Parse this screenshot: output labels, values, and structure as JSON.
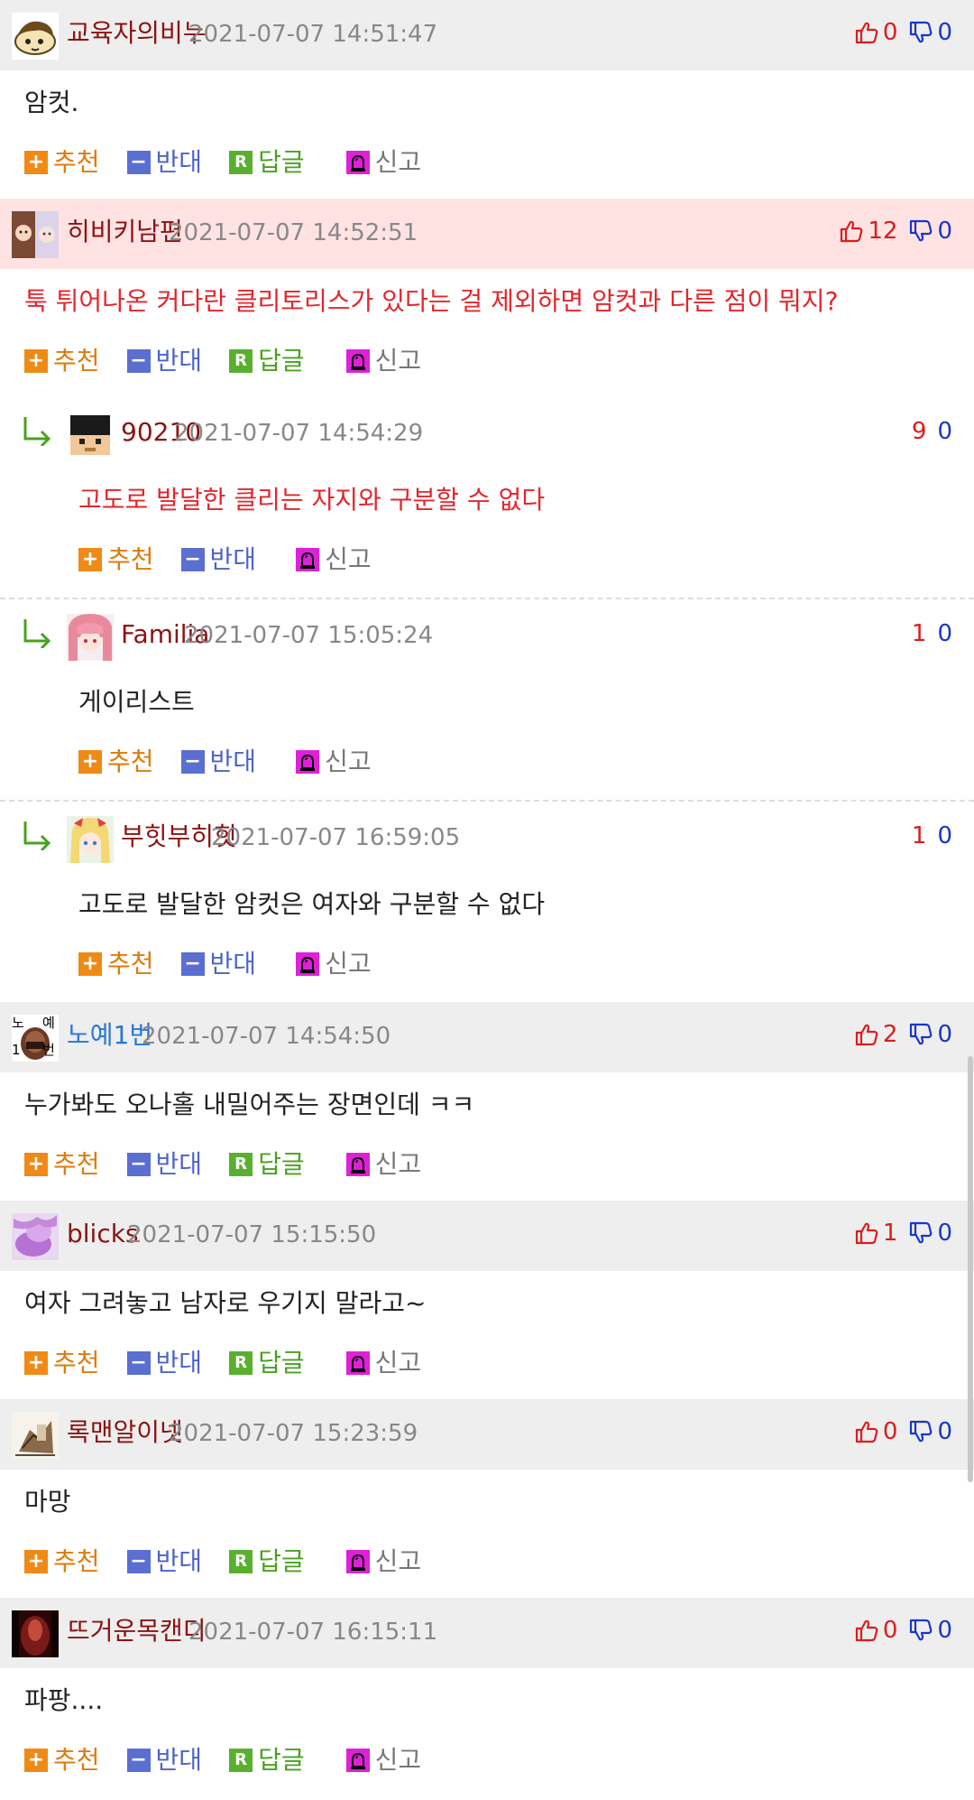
{
  "actions": {
    "recommend": "추천",
    "oppose": "반대",
    "answer": "답글",
    "report": "신고"
  },
  "icons": {
    "thumbs_up": "thumbs-up-outline-icon",
    "thumbs_down": "thumbs-down-outline-icon",
    "reply_arrow": "reply-arrow-icon",
    "recommend": "plus-box-icon",
    "oppose": "minus-box-icon",
    "answer": "r-box-icon",
    "report": "siren-icon"
  },
  "colors": {
    "best_comment_bg": "#ffe3e3",
    "comment_header_bg": "#eeeeee",
    "nickname": "#8b1212",
    "highlight_text": "#e3262c",
    "up_count": "#dd1c1c",
    "down_count": "#1a36c8"
  },
  "comments": [
    {
      "kind": "top-level",
      "best": false,
      "nickname": "교육자의비누",
      "date": "2021-07-07 14:51:47",
      "up": "0",
      "down": "0",
      "text": "암컷.",
      "text_red": false,
      "avatar": "cat-avatar"
    },
    {
      "kind": "top-level",
      "best": true,
      "nickname": "히비키남편",
      "date": "2021-07-07 14:52:51",
      "up": "12",
      "down": "0",
      "text": "툭 튀어나온 커다란 클리토리스가 있다는 걸 제외하면 암컷과 다른 점이 뭐지?",
      "text_red": true,
      "avatar": "anime-avatar"
    },
    {
      "kind": "reply",
      "nickname": "90210",
      "date": "2021-07-07 14:54:29",
      "up": "9",
      "down": "0",
      "text": "고도로 발달한 클리는 자지와 구분할 수 없다",
      "text_red": true,
      "avatar": "pixel-avatar"
    },
    {
      "kind": "reply",
      "nickname": "Familia",
      "date": "2021-07-07 15:05:24",
      "up": "1",
      "down": "0",
      "text": "게이리스트",
      "text_red": false,
      "avatar": "pink-hair-avatar"
    },
    {
      "kind": "reply",
      "nickname": "부힛부히힛",
      "date": "2021-07-07 16:59:05",
      "up": "1",
      "down": "0",
      "text": "고도로 발달한 암컷은 여자와 구분할 수 없다",
      "text_red": false,
      "avatar": "blonde-avatar"
    },
    {
      "kind": "top-level",
      "best": false,
      "nickname": "노예1번",
      "nick_blue": true,
      "date": "2021-07-07 14:54:50",
      "up": "2",
      "down": "0",
      "text": "누가봐도 오나홀 내밀어주는 장면인데 ㅋㅋ",
      "text_red": false,
      "avatar": "noye-avatar",
      "avatar_text": [
        "노",
        "예",
        "1",
        "번"
      ]
    },
    {
      "kind": "top-level",
      "best": false,
      "nickname": "blicks",
      "date": "2021-07-07 15:15:50",
      "up": "1",
      "down": "0",
      "text": "여자 그려놓고 남자로 우기지 말라고~",
      "text_red": false,
      "avatar": "purple-avatar"
    },
    {
      "kind": "top-level",
      "best": false,
      "nickname": "록맨알이넷",
      "date": "2021-07-07 15:23:59",
      "up": "0",
      "down": "0",
      "text": "마망",
      "text_red": false,
      "avatar": "sketch-avatar"
    },
    {
      "kind": "top-level",
      "best": false,
      "nickname": "뜨거운목캔디",
      "date": "2021-07-07 16:15:11",
      "up": "0",
      "down": "0",
      "text": "파팡....",
      "text_red": false,
      "avatar": "dark-avatar"
    }
  ]
}
